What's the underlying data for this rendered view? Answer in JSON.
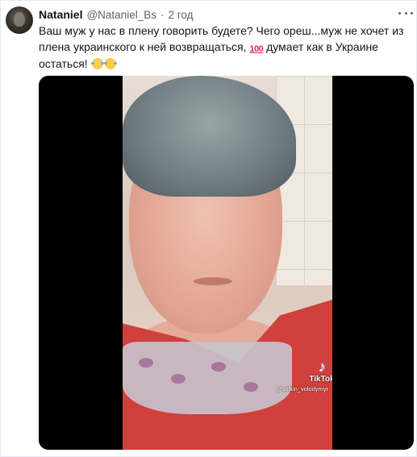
{
  "tweet": {
    "author_name": "Nataniel",
    "author_handle": "@Nataniel_Bs",
    "separator": "·",
    "time": "2 год",
    "text_part1": "Ваш муж у нас в плену говорить будете? Чего ореш...муж не хочет из плена украинского к ней возвращаться,",
    "emoji_100": "100",
    "text_part2": "думает как в Украине остаться!",
    "emoji_after_text": [
      "face-with-tears-of-joy",
      "face-with-tears-of-joy"
    ]
  },
  "media": {
    "watermark_brand": "TikTok",
    "watermark_user": "@volkin_volodymyr"
  },
  "icons": {
    "more": "more-dots-icon",
    "tiktok_logo": "tiktok-logo-icon"
  },
  "colors": {
    "name_text": "#0f1419",
    "secondary_text": "#536471",
    "media_background": "#000000",
    "hundred_emoji": "#e0245e"
  }
}
